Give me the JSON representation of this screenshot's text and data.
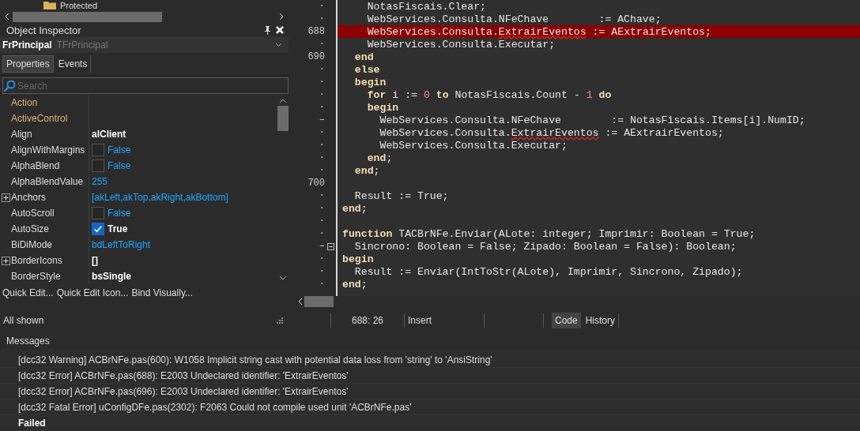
{
  "tree": {
    "item": "Protected"
  },
  "object_inspector": {
    "title": "Object Inspector",
    "object_name": "FrPrincipal",
    "object_type": "TFrPrincipal",
    "tabs": [
      {
        "label": "Properties",
        "selected": true
      },
      {
        "label": "Events",
        "selected": false
      }
    ],
    "search": {
      "placeholder": "Search"
    },
    "properties": [
      {
        "name": "Action",
        "kind": "reference"
      },
      {
        "name": "ActiveControl",
        "kind": "reference"
      },
      {
        "name": "Align",
        "kind": "value",
        "value": "alClient",
        "default": false
      },
      {
        "name": "AlignWithMargins",
        "kind": "checkbox",
        "value": "False",
        "checked": false,
        "default": true
      },
      {
        "name": "AlphaBlend",
        "kind": "checkbox",
        "value": "False",
        "checked": false,
        "default": true
      },
      {
        "name": "AlphaBlendValue",
        "kind": "value",
        "value": "255",
        "default": true
      },
      {
        "name": "Anchors",
        "kind": "value",
        "value": "[akLeft,akTop,akRight,akBottom]",
        "default": true,
        "expanded": false
      },
      {
        "name": "AutoScroll",
        "kind": "checkbox",
        "value": "False",
        "checked": false,
        "default": true
      },
      {
        "name": "AutoSize",
        "kind": "checkbox",
        "value": "True",
        "checked": true,
        "default": false
      },
      {
        "name": "BiDiMode",
        "kind": "value",
        "value": "bdLeftToRight",
        "default": true
      },
      {
        "name": "BorderIcons",
        "kind": "value",
        "value": "[]",
        "default": false,
        "expanded": false
      },
      {
        "name": "BorderStyle",
        "kind": "value",
        "value": "bsSingle",
        "default": false
      }
    ],
    "links": [
      "Quick Edit...",
      "Quick Edit Icon...",
      "Bind Visually..."
    ]
  },
  "editor": {
    "lines": [
      {
        "gutter": "·",
        "segments": [
          {
            "kind": "plain",
            "text": "    NotasFiscais.Clear;"
          }
        ]
      },
      {
        "gutter": "·",
        "segments": [
          {
            "kind": "plain",
            "text": "    WebServices.Consulta.NFeChave        := AChave;"
          }
        ]
      },
      {
        "gutter": "688",
        "error": true,
        "segments": [
          {
            "kind": "plain",
            "text": "    WebServices.Consulta."
          },
          {
            "kind": "error",
            "text": "ExtrairEventos"
          },
          {
            "kind": "plain",
            "text": " := AExtrairEventos;"
          }
        ]
      },
      {
        "gutter": "·",
        "segments": [
          {
            "kind": "plain",
            "text": "    WebServices.Consulta.Executar;"
          }
        ]
      },
      {
        "gutter": "690",
        "segments": [
          {
            "kind": "keyword",
            "text": "  end"
          }
        ]
      },
      {
        "gutter": "·",
        "segments": [
          {
            "kind": "keyword",
            "text": "  else"
          }
        ]
      },
      {
        "gutter": "·",
        "segments": [
          {
            "kind": "keyword",
            "text": "  begin"
          }
        ]
      },
      {
        "gutter": "·",
        "segments": [
          {
            "kind": "keyword",
            "text": "    for"
          },
          {
            "kind": "plain",
            "text": " i := "
          },
          {
            "kind": "number",
            "text": "0"
          },
          {
            "kind": "keyword",
            "text": " to"
          },
          {
            "kind": "plain",
            "text": " NotasFiscais.Count - "
          },
          {
            "kind": "number",
            "text": "1"
          },
          {
            "kind": "keyword",
            "text": " do"
          }
        ]
      },
      {
        "gutter": "·",
        "segments": [
          {
            "kind": "keyword",
            "text": "    begin"
          }
        ]
      },
      {
        "gutter": "–",
        "segments": [
          {
            "kind": "plain",
            "text": "      WebServices.Consulta.NFeChave        := NotasFiscais.Items[i].NumID;"
          }
        ]
      },
      {
        "gutter": "·",
        "segments": [
          {
            "kind": "plain",
            "text": "      WebServices.Consulta."
          },
          {
            "kind": "error",
            "text": "ExtrairEventos"
          },
          {
            "kind": "plain",
            "text": " := AExtrairEventos;"
          }
        ]
      },
      {
        "gutter": "·",
        "segments": [
          {
            "kind": "plain",
            "text": "      WebServices.Consulta.Executar;"
          }
        ]
      },
      {
        "gutter": "·",
        "segments": [
          {
            "kind": "keyword",
            "text": "    end"
          },
          {
            "kind": "plain",
            "text": ";"
          }
        ]
      },
      {
        "gutter": "·",
        "segments": [
          {
            "kind": "keyword",
            "text": "  end"
          },
          {
            "kind": "plain",
            "text": ";"
          }
        ]
      },
      {
        "gutter": "700"
      },
      {
        "gutter": "·",
        "segments": [
          {
            "kind": "plain",
            "text": "  Result := True;"
          }
        ]
      },
      {
        "gutter": "·",
        "segments": [
          {
            "kind": "keyword",
            "text": "end"
          },
          {
            "kind": "plain",
            "text": ";"
          }
        ]
      },
      {
        "gutter": "·"
      },
      {
        "gutter": "·",
        "segments": [
          {
            "kind": "keyword",
            "text": "function"
          },
          {
            "kind": "plain",
            "text": " TACBrNFe.Enviar(ALote: integer; Imprimir: Boolean = True;"
          }
        ]
      },
      {
        "gutter": "–",
        "fold": true,
        "segments": [
          {
            "kind": "plain",
            "text": "  Sincrono: Boolean = False; Zipado: Boolean = False): Boolean;"
          }
        ]
      },
      {
        "gutter": "·",
        "segments": [
          {
            "kind": "keyword",
            "text": "begin"
          }
        ]
      },
      {
        "gutter": "·",
        "segments": [
          {
            "kind": "plain",
            "text": "  Result := Enviar(IntToStr(ALote), Imprimir, Sincrono, Zipado);"
          }
        ]
      },
      {
        "gutter": "·",
        "segments": [
          {
            "kind": "keyword",
            "text": "end"
          },
          {
            "kind": "plain",
            "text": ";"
          }
        ]
      }
    ]
  },
  "status_bar": {
    "filter": "All shown",
    "position": "688: 26",
    "mode": "Insert",
    "tabs": [
      {
        "label": "Code",
        "selected": true
      },
      {
        "label": "History",
        "selected": false
      }
    ]
  },
  "messages": {
    "title": "Messages",
    "items": [
      {
        "kind": "message",
        "text": "[dcc32 Warning] ACBrNFe.pas(600): W1058 Implicit string cast with potential data loss from 'string' to 'AnsiString'"
      },
      {
        "kind": "message",
        "text": "[dcc32 Error] ACBrNFe.pas(688): E2003 Undeclared identifier: 'ExtrairEventos'"
      },
      {
        "kind": "message",
        "text": "[dcc32 Error] ACBrNFe.pas(696): E2003 Undeclared identifier: 'ExtrairEventos'"
      },
      {
        "kind": "message",
        "text": "[dcc32 Fatal Error] uConfigDFe.pas(2302): F2063 Could not compile used unit 'ACBrNFe.pas'"
      },
      {
        "kind": "result",
        "text": "Failed"
      }
    ]
  }
}
